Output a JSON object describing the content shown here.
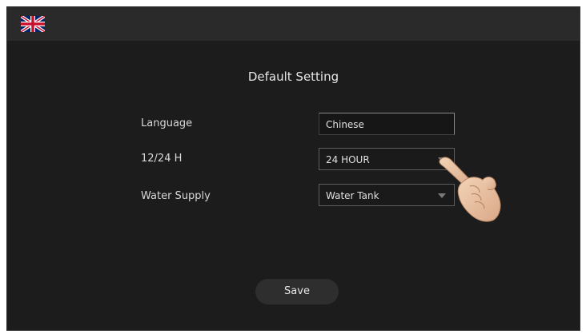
{
  "header": {
    "flag_icon": "uk-flag-icon"
  },
  "page": {
    "title": "Default Setting"
  },
  "settings": [
    {
      "label": "Language",
      "value": "Chinese",
      "kind": "text"
    },
    {
      "label": "12/24 H",
      "value": "24 HOUR",
      "kind": "select"
    },
    {
      "label": "Water Supply",
      "value": "Water Tank",
      "kind": "select"
    }
  ],
  "actions": {
    "save_label": "Save"
  },
  "overlay": {
    "pointer_icon": "pointing-hand-icon"
  }
}
